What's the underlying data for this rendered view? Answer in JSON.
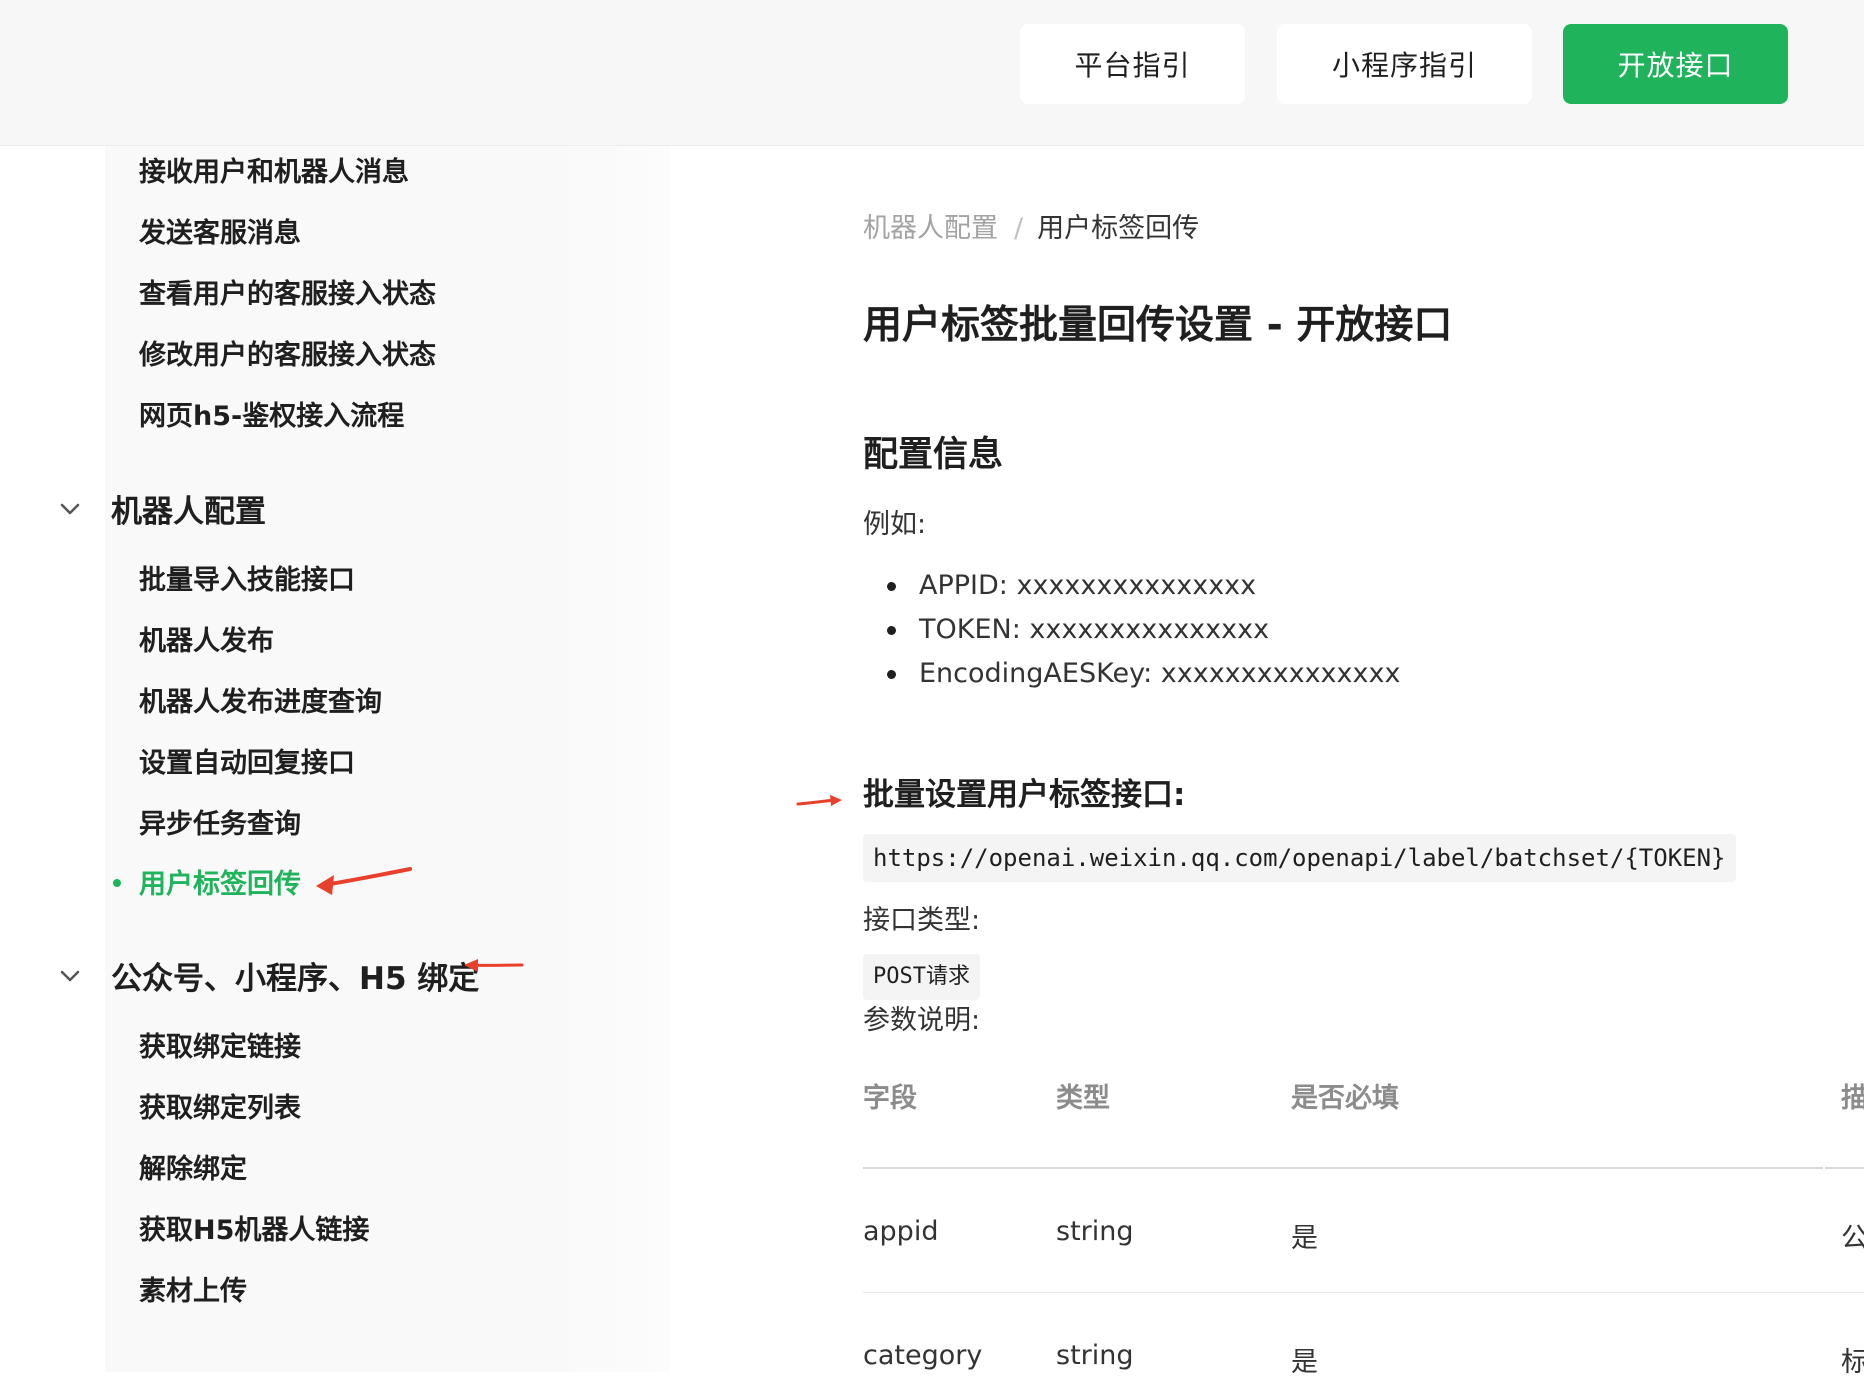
{
  "header": {
    "buttons": [
      {
        "label": "平台指引"
      },
      {
        "label": "小程序指引"
      },
      {
        "label": "开放接口"
      }
    ]
  },
  "sidebar": {
    "top_items": [
      {
        "label": "接收用户和机器人消息"
      },
      {
        "label": "发送客服消息"
      },
      {
        "label": "查看用户的客服接入状态"
      },
      {
        "label": "修改用户的客服接入状态"
      },
      {
        "label": "网页h5-鉴权接入流程"
      }
    ],
    "groups": [
      {
        "label": "机器人配置",
        "items": [
          {
            "label": "批量导入技能接口"
          },
          {
            "label": "机器人发布"
          },
          {
            "label": "机器人发布进度查询"
          },
          {
            "label": "设置自动回复接口"
          },
          {
            "label": "异步任务查询"
          },
          {
            "label": "用户标签回传"
          }
        ]
      },
      {
        "label": "公众号、小程序、H5 绑定",
        "items": [
          {
            "label": "获取绑定链接"
          },
          {
            "label": "获取绑定列表"
          },
          {
            "label": "解除绑定"
          },
          {
            "label": "获取H5机器人链接"
          },
          {
            "label": "素材上传"
          }
        ]
      }
    ],
    "active_item": "用户标签回传"
  },
  "main": {
    "breadcrumb": {
      "parent": "机器人配置",
      "separator": "/",
      "current": "用户标签回传"
    },
    "title": "用户标签批量回传设置 - 开放接口",
    "config_section": {
      "title": "配置信息",
      "example_label": "例如:",
      "items": [
        "APPID: xxxxxxxxxxxxxxx",
        "TOKEN: xxxxxxxxxxxxxxx",
        "EncodingAESKey: xxxxxxxxxxxxxxx"
      ]
    },
    "api_section": {
      "title": "批量设置用户标签接口:",
      "url": "https://openai.weixin.qq.com/openapi/label/batchset/{TOKEN}",
      "type_label": "接口类型:",
      "method": "POST请求",
      "params_label": "参数说明:"
    },
    "table": {
      "headers": [
        "字段",
        "类型",
        "是否必填",
        "描"
      ],
      "rows": [
        [
          "appid",
          "string",
          "是",
          "公"
        ],
        [
          "category",
          "string",
          "是",
          "标"
        ]
      ]
    }
  },
  "colors": {
    "accent": "#1fb45c",
    "annotation": "#e8402a",
    "topbar_bg": "#f7f7f7",
    "sidebar_bg": "#f9f9f9"
  }
}
